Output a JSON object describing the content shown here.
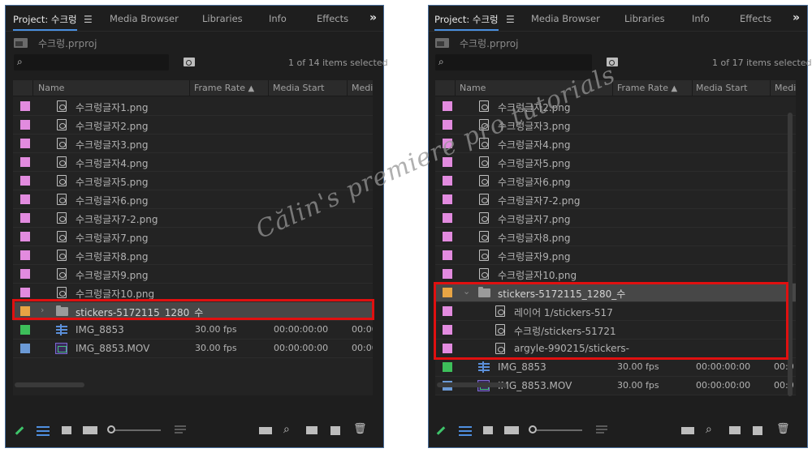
{
  "left": {
    "tabs": [
      "Project: 수크렁",
      "Media Browser",
      "Libraries",
      "Info",
      "Effects"
    ],
    "project_file": "수크렁.prproj",
    "items_selected": "1 of 14 items selected",
    "columns": [
      "Name",
      "Frame Rate",
      "Media Start",
      "Media"
    ],
    "rows": [
      {
        "name": "수크렁글자1.png",
        "color": "#e28bdf",
        "kind": "image"
      },
      {
        "name": "수크렁글자2.png",
        "color": "#e28bdf",
        "kind": "image"
      },
      {
        "name": "수크렁글자3.png",
        "color": "#e28bdf",
        "kind": "image"
      },
      {
        "name": "수크렁글자4.png",
        "color": "#e28bdf",
        "kind": "image"
      },
      {
        "name": "수크렁글자5.png",
        "color": "#e28bdf",
        "kind": "image"
      },
      {
        "name": "수크렁글자6.png",
        "color": "#e28bdf",
        "kind": "image"
      },
      {
        "name": "수크렁글자7-2.png",
        "color": "#e28bdf",
        "kind": "image"
      },
      {
        "name": "수크렁글자7.png",
        "color": "#e28bdf",
        "kind": "image"
      },
      {
        "name": "수크렁글자8.png",
        "color": "#e28bdf",
        "kind": "image"
      },
      {
        "name": "수크렁글자9.png",
        "color": "#e28bdf",
        "kind": "image"
      },
      {
        "name": "수크렁글자10.png",
        "color": "#e28bdf",
        "kind": "image"
      },
      {
        "name": "stickers-5172115_1280_수",
        "color": "#e8a444",
        "kind": "bin-collapsed"
      },
      {
        "name": "IMG_8853",
        "color": "#3dbf5a",
        "kind": "sequence",
        "frame_rate": "30.00 fps",
        "media_start": "00:00:00:00",
        "media_end": "00:00"
      },
      {
        "name": "IMG_8853.MOV",
        "color": "#6b9ad6",
        "kind": "movie",
        "frame_rate": "30.00 fps",
        "media_start": "00:00:00:00",
        "media_end": "00:00"
      }
    ]
  },
  "right": {
    "tabs": [
      "Project: 수크렁",
      "Media Browser",
      "Libraries",
      "Info",
      "Effects"
    ],
    "project_file": "수크렁.prproj",
    "items_selected": "1 of 17 items selected",
    "columns": [
      "Name",
      "Frame Rate",
      "Media Start",
      "Media"
    ],
    "rows": [
      {
        "name": "수크렁글자2.png",
        "color": "#e28bdf",
        "kind": "image"
      },
      {
        "name": "수크렁글자3.png",
        "color": "#e28bdf",
        "kind": "image"
      },
      {
        "name": "수크렁글자4.png",
        "color": "#e28bdf",
        "kind": "image"
      },
      {
        "name": "수크렁글자5.png",
        "color": "#e28bdf",
        "kind": "image"
      },
      {
        "name": "수크렁글자6.png",
        "color": "#e28bdf",
        "kind": "image"
      },
      {
        "name": "수크렁글자7-2.png",
        "color": "#e28bdf",
        "kind": "image"
      },
      {
        "name": "수크렁글자7.png",
        "color": "#e28bdf",
        "kind": "image"
      },
      {
        "name": "수크렁글자8.png",
        "color": "#e28bdf",
        "kind": "image"
      },
      {
        "name": "수크렁글자9.png",
        "color": "#e28bdf",
        "kind": "image"
      },
      {
        "name": "수크렁글자10.png",
        "color": "#e28bdf",
        "kind": "image"
      },
      {
        "name": "stickers-5172115_1280_수",
        "color": "#e8a444",
        "kind": "bin-expanded"
      },
      {
        "name": "레이어 1/stickers-517",
        "color": "#e28bdf",
        "kind": "image-child"
      },
      {
        "name": "수크렁/stickers-51721",
        "color": "#e28bdf",
        "kind": "image-child"
      },
      {
        "name": "argyle-990215/stickers-",
        "color": "#e28bdf",
        "kind": "image-child"
      },
      {
        "name": "IMG_8853",
        "color": "#3dbf5a",
        "kind": "sequence",
        "frame_rate": "30.00 fps",
        "media_start": "00:00:00:00",
        "media_end": "00:0"
      },
      {
        "name": "IMG_8853.MOV",
        "color": "#6b9ad6",
        "kind": "movie",
        "frame_rate": "30.00 fps",
        "media_start": "00:00:00:00",
        "media_end": "00:0"
      }
    ]
  },
  "watermark": "Călin's premiere pro tutorials",
  "colors": {
    "highlight": "#e01010",
    "accent": "#4a8fe0",
    "panel_bg": "#1e1e1e"
  }
}
